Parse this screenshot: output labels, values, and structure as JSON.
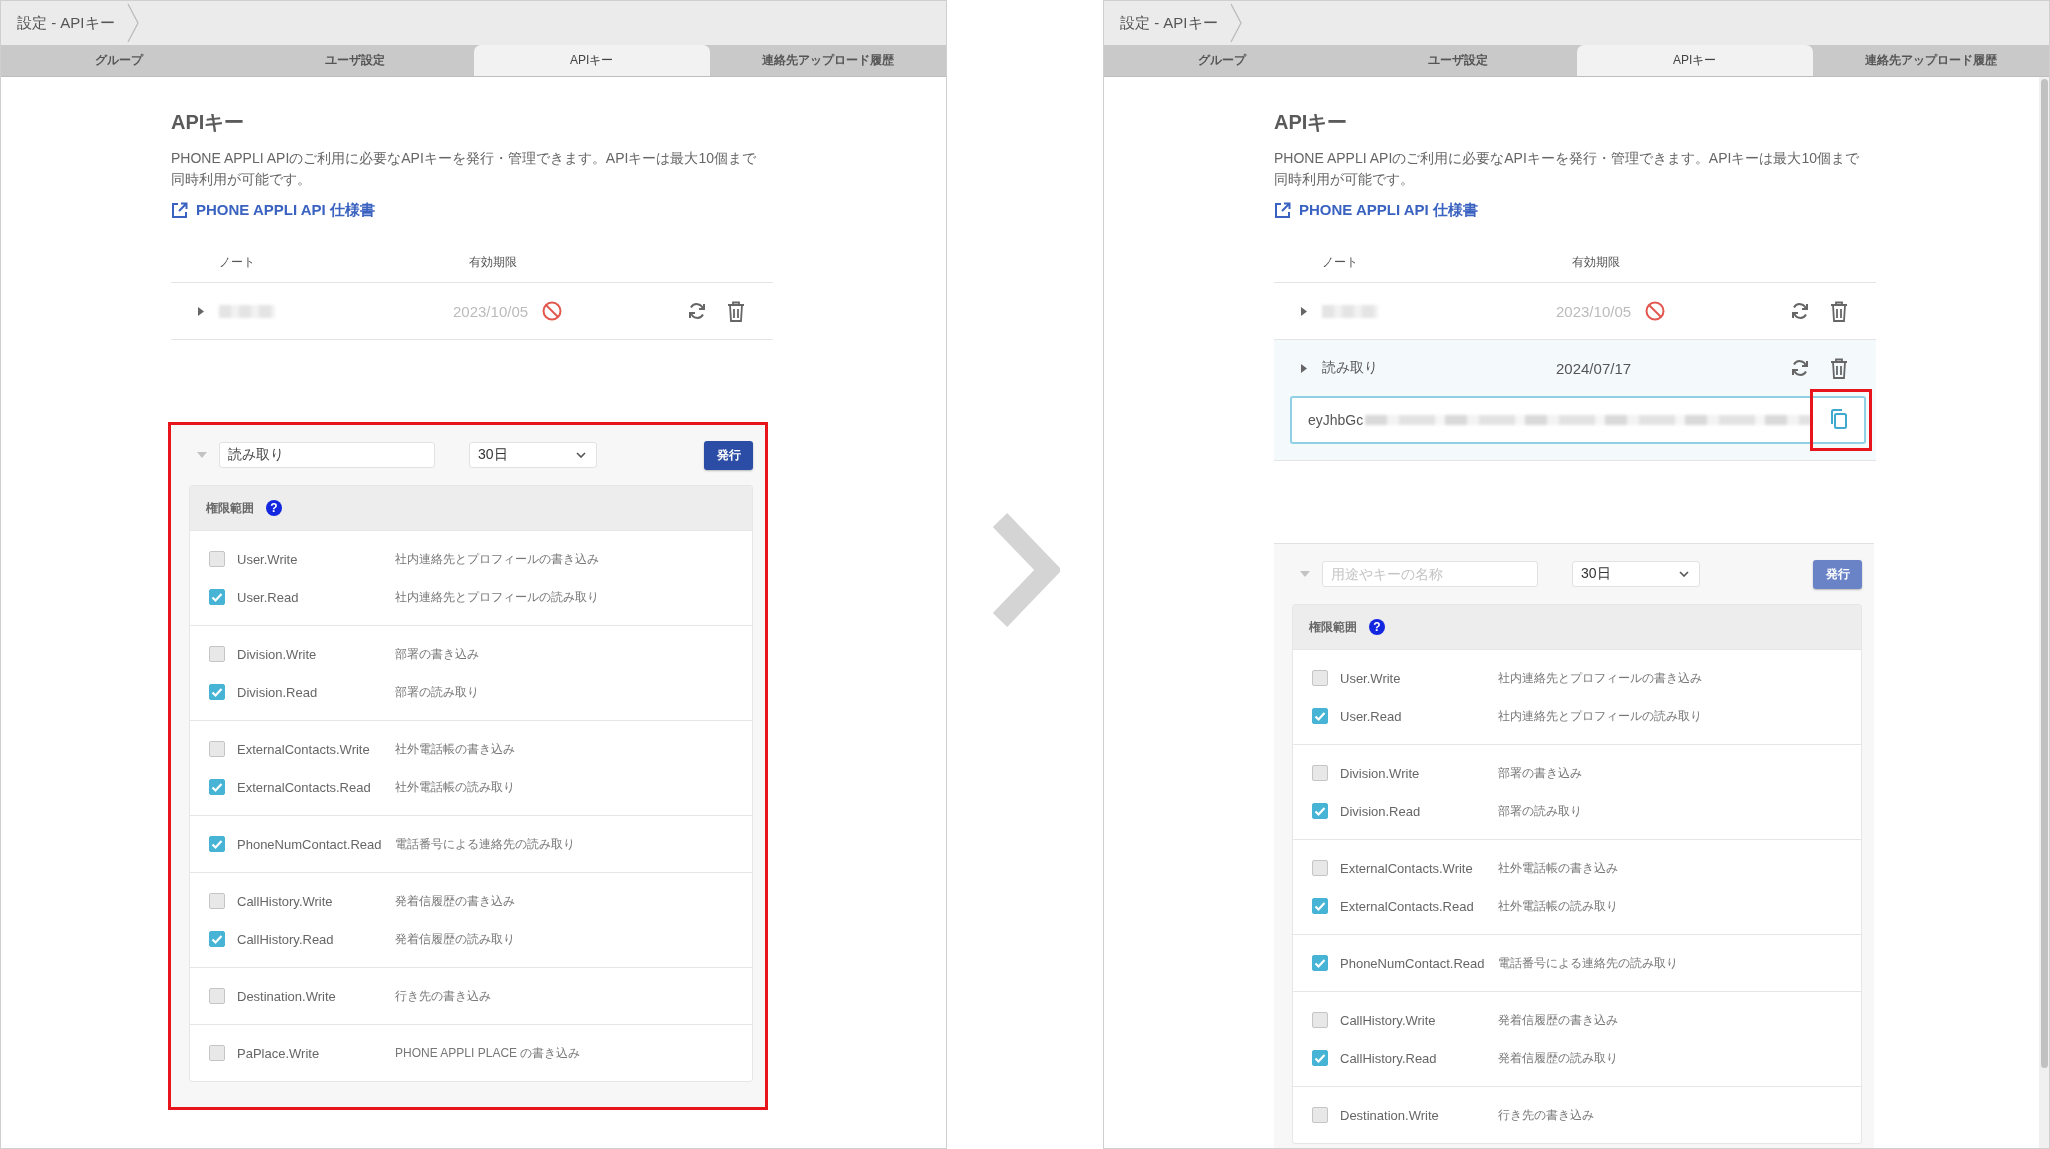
{
  "panels": [
    {
      "breadcrumb": "設定 - APIキー",
      "tabs": [
        {
          "label": "グループ",
          "selected": false
        },
        {
          "label": "ユーザ設定",
          "selected": false
        },
        {
          "label": "APIキー",
          "selected": true
        },
        {
          "label": "連絡先アップロード履歴",
          "selected": false
        }
      ],
      "heading": "APIキー",
      "description": "PHONE APPLI APIのご利用に必要なAPIキーを発行・管理できます。APIキーは最大10個まで同時利用が可能です。",
      "doc_link": "PHONE APPLI API 仕様書",
      "columns": [
        "ノート",
        "有効期限"
      ],
      "keys": [
        {
          "note_redacted": true,
          "expiry": "2023/10/05",
          "expired": true,
          "expanded": false
        }
      ],
      "new_key": {
        "highlighted": true,
        "name": "読み取り",
        "period": "30日",
        "issue_button": "発行",
        "disabled": false,
        "scope_title": "権限範囲",
        "help": "?",
        "groups": [
          {
            "permissions": [
              {
                "name": "User.Write",
                "description": "社内連絡先とプロフィールの書き込み",
                "checked": false
              },
              {
                "name": "User.Read",
                "description": "社内連絡先とプロフィールの読み取り",
                "checked": true
              }
            ]
          },
          {
            "permissions": [
              {
                "name": "Division.Write",
                "description": "部署の書き込み",
                "checked": false
              },
              {
                "name": "Division.Read",
                "description": "部署の読み取り",
                "checked": true
              }
            ]
          },
          {
            "permissions": [
              {
                "name": "ExternalContacts.Write",
                "description": "社外電話帳の書き込み",
                "checked": false
              },
              {
                "name": "ExternalContacts.Read",
                "description": "社外電話帳の読み取り",
                "checked": true
              }
            ]
          },
          {
            "permissions": [
              {
                "name": "PhoneNumContact.Read",
                "description": "電話番号による連絡先の読み取り",
                "checked": true
              }
            ]
          },
          {
            "permissions": [
              {
                "name": "CallHistory.Write",
                "description": "発着信履歴の書き込み",
                "checked": false
              },
              {
                "name": "CallHistory.Read",
                "description": "発着信履歴の読み取り",
                "checked": true
              }
            ]
          },
          {
            "permissions": [
              {
                "name": "Destination.Write",
                "description": "行き先の書き込み",
                "checked": false
              }
            ]
          },
          {
            "permissions": [
              {
                "name": "PaPlace.Write",
                "description": "PHONE APPLI PLACE の書き込み",
                "checked": false
              }
            ]
          }
        ]
      }
    },
    {
      "breadcrumb": "設定 - APIキー",
      "tabs": [
        {
          "label": "グループ",
          "selected": false
        },
        {
          "label": "ユーザ設定",
          "selected": false
        },
        {
          "label": "APIキー",
          "selected": true
        },
        {
          "label": "連絡先アップロード履歴",
          "selected": false
        }
      ],
      "heading": "APIキー",
      "description": "PHONE APPLI APIのご利用に必要なAPIキーを発行・管理できます。APIキーは最大10個まで同時利用が可能です。",
      "doc_link": "PHONE APPLI API 仕様書",
      "columns": [
        "ノート",
        "有効期限"
      ],
      "scrollbar": true,
      "keys": [
        {
          "note_redacted": true,
          "expiry": "2023/10/05",
          "expired": true,
          "expanded": false
        },
        {
          "note": "読み取り",
          "expiry": "2024/07/17",
          "expired": false,
          "expanded": true,
          "key_prefix": "eyJhbGc",
          "copy_highlighted": true
        }
      ],
      "new_key": {
        "highlighted": false,
        "placeholder": "用途やキーの名称",
        "period": "30日",
        "issue_button": "発行",
        "disabled": true,
        "scope_title": "権限範囲",
        "help": "?",
        "groups": [
          {
            "permissions": [
              {
                "name": "User.Write",
                "description": "社内連絡先とプロフィールの書き込み",
                "checked": false
              },
              {
                "name": "User.Read",
                "description": "社内連絡先とプロフィールの読み取り",
                "checked": true
              }
            ]
          },
          {
            "permissions": [
              {
                "name": "Division.Write",
                "description": "部署の書き込み",
                "checked": false
              },
              {
                "name": "Division.Read",
                "description": "部署の読み取り",
                "checked": true
              }
            ]
          },
          {
            "permissions": [
              {
                "name": "ExternalContacts.Write",
                "description": "社外電話帳の書き込み",
                "checked": false
              },
              {
                "name": "ExternalContacts.Read",
                "description": "社外電話帳の読み取り",
                "checked": true
              }
            ]
          },
          {
            "permissions": [
              {
                "name": "PhoneNumContact.Read",
                "description": "電話番号による連絡先の読み取り",
                "checked": true
              }
            ]
          },
          {
            "permissions": [
              {
                "name": "CallHistory.Write",
                "description": "発着信履歴の書き込み",
                "checked": false
              },
              {
                "name": "CallHistory.Read",
                "description": "発着信履歴の読み取り",
                "checked": true
              }
            ]
          },
          {
            "permissions": [
              {
                "name": "Destination.Write",
                "description": "行き先の書き込み",
                "checked": false
              }
            ]
          }
        ]
      }
    }
  ]
}
